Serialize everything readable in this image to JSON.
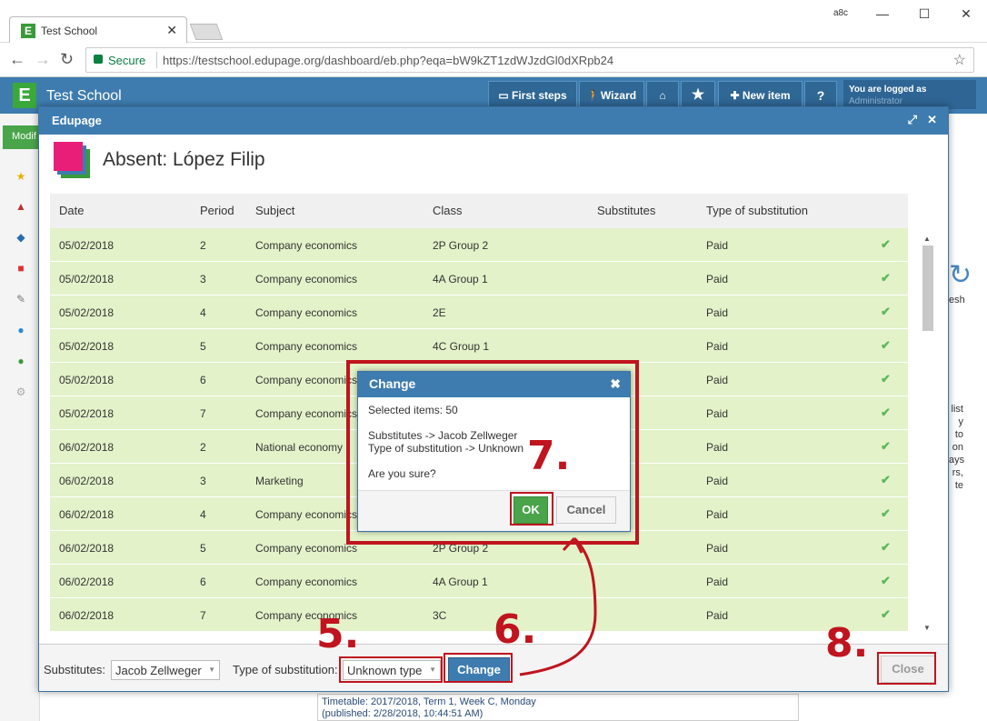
{
  "browser": {
    "tab_title": "Test School",
    "secure_label": "Secure",
    "url": "https://testschool.edupage.org/dashboard/eb.php?eqa=bW9kZT1zdWJzdGl0dXRpb24"
  },
  "header": {
    "app_name": "Test School",
    "first_steps": "First steps",
    "wizard": "Wizard",
    "new_item": "New item",
    "help": "?",
    "logged_in_label": "You are logged as",
    "user": "Administrator"
  },
  "sidebar": {
    "modify_label": "Modif"
  },
  "background": {
    "right_refresh": "esh",
    "right_text": [
      "list",
      "y to",
      "on",
      "ays",
      "rs,",
      "te"
    ],
    "timetable_line1": "Timetable: 2017/2018, Term 1, Week C, Monday",
    "timetable_line2": "(published: 2/28/2018, 10:44:51 AM)"
  },
  "dialog": {
    "title": "Edupage",
    "absent_title": "Absent: López Filip",
    "columns": [
      "Date",
      "Period",
      "Subject",
      "Class",
      "Substitutes",
      "Type of substitution"
    ],
    "rows": [
      {
        "date": "05/02/2018",
        "period": "2",
        "subject": "Company economics",
        "class": "2P Group 2",
        "subs": "",
        "type": "Paid"
      },
      {
        "date": "05/02/2018",
        "period": "3",
        "subject": "Company economics",
        "class": "4A Group 1",
        "subs": "",
        "type": "Paid"
      },
      {
        "date": "05/02/2018",
        "period": "4",
        "subject": "Company economics",
        "class": "2E",
        "subs": "",
        "type": "Paid"
      },
      {
        "date": "05/02/2018",
        "period": "5",
        "subject": "Company economics",
        "class": "4C Group 1",
        "subs": "",
        "type": "Paid"
      },
      {
        "date": "05/02/2018",
        "period": "6",
        "subject": "Company economics",
        "class": "",
        "subs": "",
        "type": "Paid"
      },
      {
        "date": "05/02/2018",
        "period": "7",
        "subject": "Company economics",
        "class": "",
        "subs": "",
        "type": "Paid"
      },
      {
        "date": "06/02/2018",
        "period": "2",
        "subject": "National economy",
        "class": "",
        "subs": "",
        "type": "Paid"
      },
      {
        "date": "06/02/2018",
        "period": "3",
        "subject": "Marketing",
        "class": "",
        "subs": "",
        "type": "Paid"
      },
      {
        "date": "06/02/2018",
        "period": "4",
        "subject": "Company economics",
        "class": "",
        "subs": "",
        "type": "Paid"
      },
      {
        "date": "06/02/2018",
        "period": "5",
        "subject": "Company economics",
        "class": "2P Group 2",
        "subs": "",
        "type": "Paid"
      },
      {
        "date": "06/02/2018",
        "period": "6",
        "subject": "Company economics",
        "class": "4A Group 1",
        "subs": "",
        "type": "Paid"
      },
      {
        "date": "06/02/2018",
        "period": "7",
        "subject": "Company economics",
        "class": "3C",
        "subs": "",
        "type": "Paid"
      }
    ],
    "footer": {
      "substitutes_label": "Substitutes:",
      "substitutes_value": "Jacob Zellweger",
      "type_label": "Type of substitution:",
      "type_value": "Unknown type",
      "change_button": "Change",
      "close_button": "Close"
    }
  },
  "confirm": {
    "title": "Change",
    "selected": "Selected items: 50",
    "line1": "Substitutes -> Jacob Zellweger",
    "line2": "Type of substitution -> Unknown",
    "question": "Are you sure?",
    "ok": "OK",
    "cancel": "Cancel"
  },
  "annotations": {
    "step5": "5.",
    "step6": "6.",
    "step7": "7.",
    "step8": "8."
  },
  "colors": {
    "header_blue": "#3e7cb0",
    "row_green": "#e3f2c9",
    "annotation_red": "#c0141e",
    "ok_green": "#4aa44a"
  }
}
